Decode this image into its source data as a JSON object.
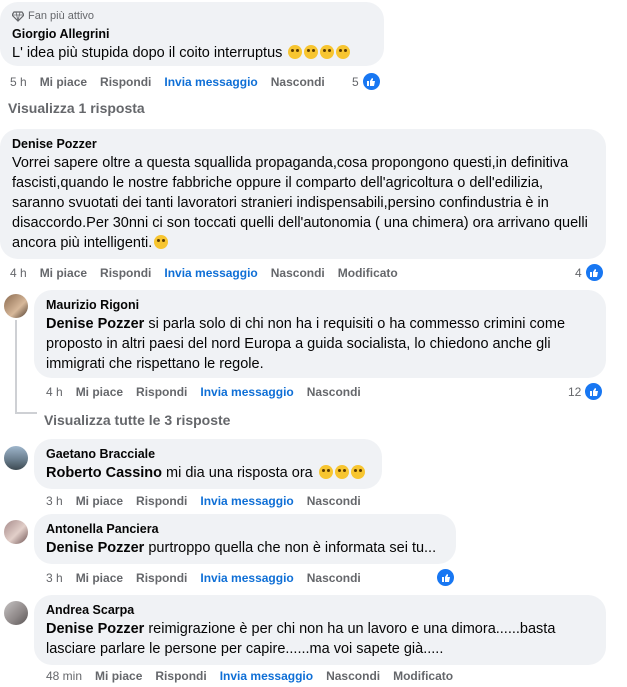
{
  "c1": {
    "badge": "Fan più attivo",
    "author": "Giorgio Allegrini",
    "text": "L' idea più stupida dopo il coito interruptus",
    "time": "5 h",
    "likes": "5",
    "actions": {
      "like": "Mi piace",
      "reply": "Rispondi",
      "message": "Invia messaggio",
      "hide": "Nascondi"
    }
  },
  "view_one_reply": "Visualizza 1 risposta",
  "c2": {
    "author": "Denise Pozzer",
    "text": "Vorrei sapere oltre a questa squallida propaganda,cosa propongono questi,in definitiva fascisti,quando le nostre fabbriche oppure il comparto dell'agricoltura o dell'edilizia, saranno svuotati dei tanti lavoratori stranieri indispensabili,persino confindustria è in disaccordo.Per 30nni ci son toccati quelli dell'autonomia ( una chimera) ora arrivano quelli ancora più intelligenti.",
    "time": "4 h",
    "likes": "4",
    "actions": {
      "like": "Mi piace",
      "reply": "Rispondi",
      "message": "Invia messaggio",
      "hide": "Nascondi",
      "edited": "Modificato"
    }
  },
  "r1": {
    "author": "Maurizio Rigoni",
    "mention": "Denise Pozzer",
    "text": " si parla solo di chi non ha i requisiti o ha commesso crimini come proposto in altri paesi del nord Europa a guida socialista, lo chiedono anche gli immigrati che rispettano le regole.",
    "time": "4 h",
    "likes": "12",
    "actions": {
      "like": "Mi piace",
      "reply": "Rispondi",
      "message": "Invia messaggio",
      "hide": "Nascondi"
    }
  },
  "view_all_replies": "Visualizza tutte le 3 risposte",
  "c3": {
    "author": "Gaetano Bracciale",
    "mention": "Roberto Cassino",
    "text": " mi dia una risposta ora",
    "time": "3 h",
    "actions": {
      "like": "Mi piace",
      "reply": "Rispondi",
      "message": "Invia messaggio",
      "hide": "Nascondi"
    }
  },
  "c4": {
    "author": "Antonella Panciera",
    "mention": "Denise Pozzer",
    "text": " purtroppo quella che non è informata sei tu...",
    "time": "3 h",
    "actions": {
      "like": "Mi piace",
      "reply": "Rispondi",
      "message": "Invia messaggio",
      "hide": "Nascondi"
    }
  },
  "c5": {
    "author": "Andrea Scarpa",
    "mention": "Denise Pozzer",
    "text": " reimigrazione è per chi non ha un lavoro e una dimora......basta lasciare parlare le persone per capire......ma voi sapete già.....",
    "time": "48 min",
    "actions": {
      "like": "Mi piace",
      "reply": "Rispondi",
      "message": "Invia messaggio",
      "hide": "Nascondi",
      "edited": "Modificato"
    }
  },
  "colors": {
    "link": "#0f6fd6",
    "bubble": "#f0f2f5",
    "like": "#1877f2",
    "muted": "#65676b"
  },
  "icons": [
    "diamond-icon",
    "thumbs-up-icon",
    "laughing-emoji",
    "thinking-emoji",
    "wink-emoji"
  ]
}
